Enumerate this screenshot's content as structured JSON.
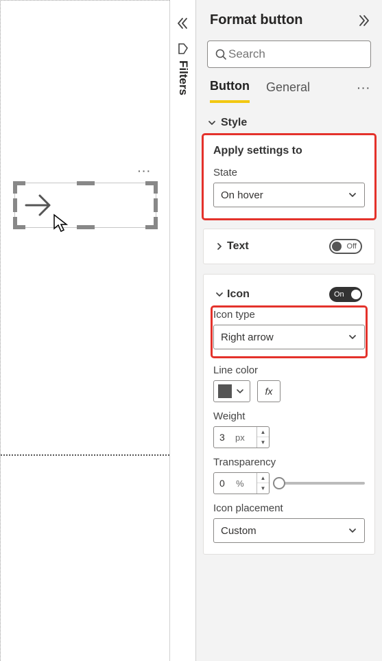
{
  "canvas": {
    "moreGlyph": "···"
  },
  "filters": {
    "label": "Filters"
  },
  "pane": {
    "title": "Format button",
    "search": {
      "placeholder": "Search"
    },
    "tabs": {
      "button": "Button",
      "general": "General",
      "moreGlyph": "···"
    },
    "style": {
      "heading": "Style",
      "apply": {
        "title": "Apply settings to",
        "stateLabel": "State",
        "stateValue": "On hover"
      },
      "text": {
        "title": "Text",
        "toggleLabel": "Off",
        "toggleState": "off"
      },
      "icon": {
        "title": "Icon",
        "toggleLabel": "On",
        "toggleState": "on",
        "typeLabel": "Icon type",
        "typeValue": "Right arrow",
        "lineColorLabel": "Line color",
        "lineColorValue": "#555555",
        "fxLabel": "fx",
        "weightLabel": "Weight",
        "weightValue": "3",
        "weightUnit": "px",
        "transparencyLabel": "Transparency",
        "transparencyValue": "0",
        "transparencyUnit": "%",
        "placementLabel": "Icon placement",
        "placementValue": "Custom"
      }
    }
  }
}
